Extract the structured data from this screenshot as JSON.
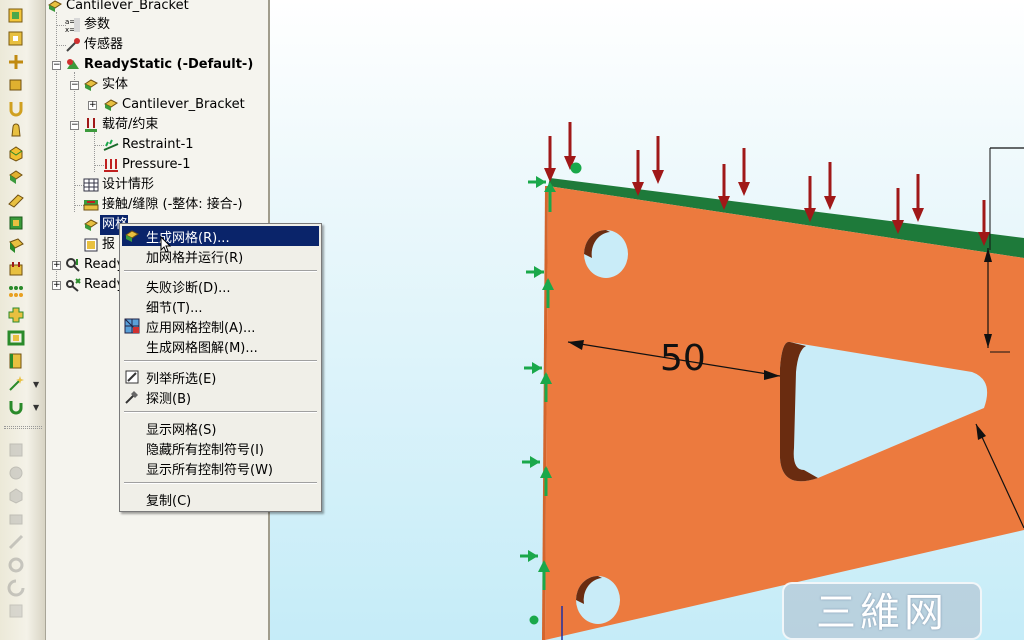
{
  "tree": {
    "root": "Cantilever_Bracket",
    "items": [
      {
        "label": "参数",
        "icon": "parameters-icon"
      },
      {
        "label": "传感器",
        "icon": "sensor-icon"
      },
      {
        "label": "ReadyStatic (-Default-)",
        "icon": "study-icon"
      },
      {
        "label": "实体",
        "icon": "solid-bodies-icon"
      },
      {
        "label": "Cantilever_Bracket",
        "icon": "part-icon"
      },
      {
        "label": "载荷/约束",
        "icon": "loads-icon"
      },
      {
        "label": "Restraint-1",
        "icon": "restraint-icon"
      },
      {
        "label": "Pressure-1",
        "icon": "pressure-icon"
      },
      {
        "label": "设计情形",
        "icon": "design-scenario-icon"
      },
      {
        "label": "接触/缝隙 (-整体: 接合-)",
        "icon": "contact-icon"
      },
      {
        "label": "网格",
        "icon": "mesh-icon"
      },
      {
        "label": "报",
        "icon": "report-icon"
      },
      {
        "label": "Ready",
        "icon": "study-icon"
      },
      {
        "label": "Ready",
        "icon": "study-icon"
      }
    ]
  },
  "context_menu": {
    "items": [
      {
        "label": "生成网格(R)...",
        "icon": "mesh-create-icon"
      },
      {
        "label": "加网格并运行(R)"
      },
      {
        "label": "失败诊断(D)..."
      },
      {
        "label": "细节(T)..."
      },
      {
        "label": "应用网格控制(A)...",
        "icon": "mesh-control-icon"
      },
      {
        "label": "生成网格图解(M)..."
      },
      {
        "label": "列举所选(E)",
        "icon": "list-selected-icon"
      },
      {
        "label": "探测(B)",
        "icon": "probe-icon"
      },
      {
        "label": "显示网格(S)"
      },
      {
        "label": "隐藏所有控制符号(I)"
      },
      {
        "label": "显示所有控制符号(W)"
      },
      {
        "label": "复制(C)"
      }
    ]
  },
  "viewport": {
    "dimension": "50",
    "watermark": "三維网"
  },
  "colors": {
    "part_face": "#ec7a3e",
    "edge_green": "#1e7a3a",
    "load_arrow": "#a01818",
    "fixture_green": "#1aa84a",
    "menu_highlight": "#0a246a"
  }
}
